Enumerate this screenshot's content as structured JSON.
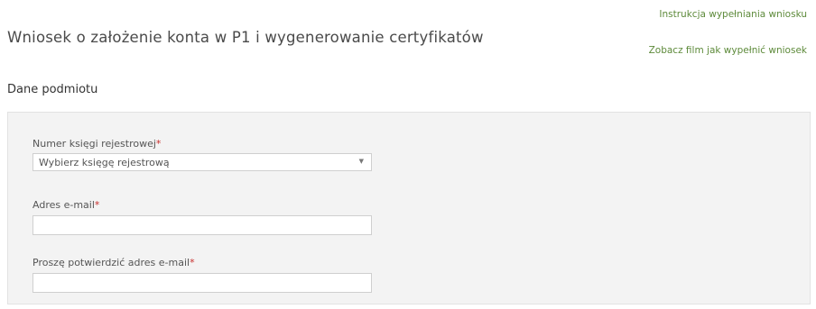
{
  "header": {
    "title": "Wniosek o założenie konta w P1 i wygenerowanie certyfikatów",
    "links": [
      "Instrukcja wypełniania wniosku",
      "Zobacz film jak wypełnić wniosek"
    ]
  },
  "section": {
    "title": "Dane podmiotu"
  },
  "form": {
    "required_marker": "*",
    "register_book": {
      "label": "Numer księgi rejestrowej",
      "selected": "Wybierz księgę rejestrową"
    },
    "email": {
      "label": "Adres e-mail",
      "value": ""
    },
    "email_confirm": {
      "label": "Proszę potwierdzić adres e-mail",
      "value": ""
    }
  },
  "colors": {
    "link": "#5d8a3a",
    "required": "#c8312f",
    "panel_bg": "#f3f3f3"
  }
}
